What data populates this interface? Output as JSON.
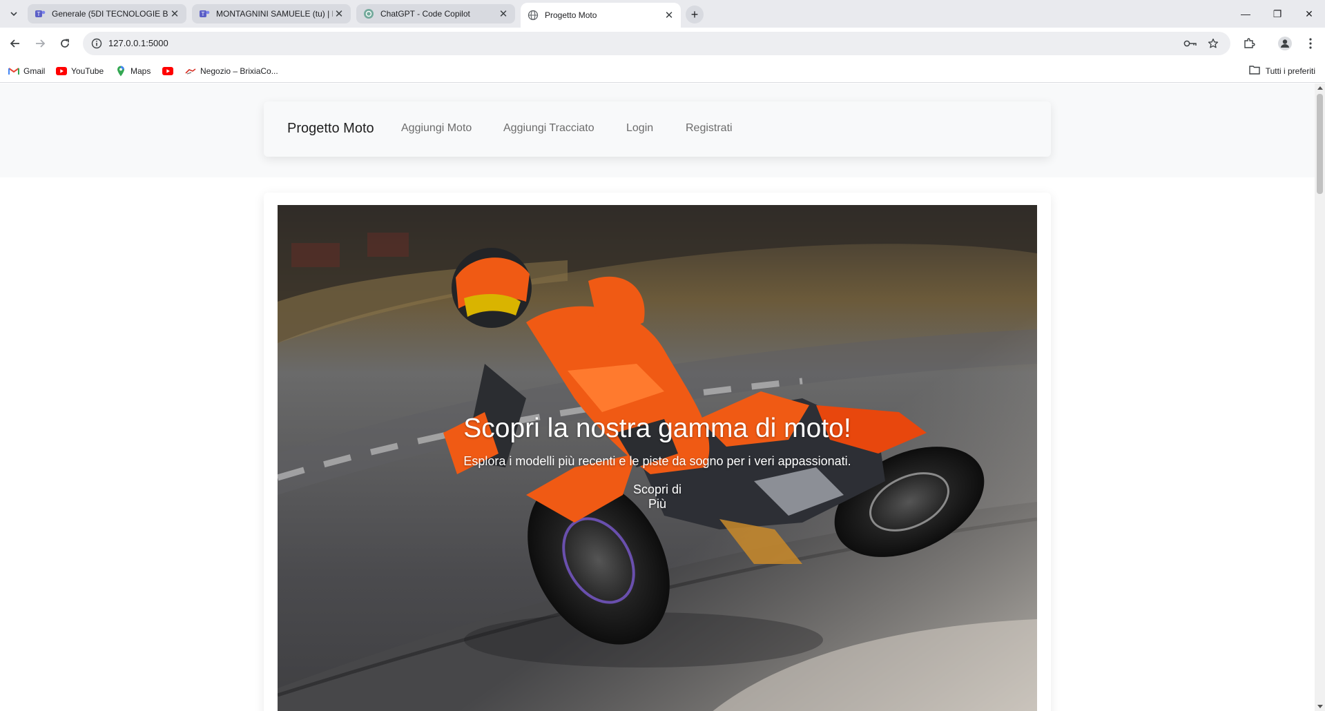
{
  "browser": {
    "tabs": [
      {
        "title": "Generale (5DI TECNOLOGIE BE",
        "icon": "teams-icon",
        "active": false
      },
      {
        "title": "MONTAGNINI SAMUELE (tu) | M",
        "icon": "teams-icon",
        "active": false
      },
      {
        "title": "ChatGPT - Code Copilot",
        "icon": "chatgpt-icon",
        "active": false
      },
      {
        "title": "Progetto Moto",
        "icon": "globe-icon",
        "active": true
      }
    ],
    "new_tab_glyph": "+",
    "window_controls": {
      "minimize": "—",
      "restore": "❐",
      "close": "✕"
    },
    "url": "127.0.0.1:5000",
    "bookmarks": [
      {
        "label": "Gmail",
        "icon": "gmail-icon"
      },
      {
        "label": "YouTube",
        "icon": "youtube-icon"
      },
      {
        "label": "Maps",
        "icon": "maps-icon"
      },
      {
        "label": "",
        "icon": "youtube-icon"
      },
      {
        "label": "Negozio – BrixiaCo...",
        "icon": "motorbike-icon"
      }
    ],
    "all_bookmarks_label": "Tutti i preferiti",
    "colors": {
      "tabbar": "#e9eaee",
      "omnibox": "#edeef1"
    }
  },
  "site": {
    "brand": "Progetto Moto",
    "nav": [
      "Aggiungi Moto",
      "Aggiungi Tracciato",
      "Login",
      "Registrati"
    ],
    "hero": {
      "title": "Scopri la nostra gamma di moto!",
      "subtitle": "Esplora i modelli più recenti e le piste da sogno per i veri appassionati.",
      "button": "Scopri di Più",
      "image": "motorcycle-rider-track-photo"
    },
    "colors": {
      "header_bg": "#f8f9fa",
      "accent": "#f05a14"
    }
  }
}
